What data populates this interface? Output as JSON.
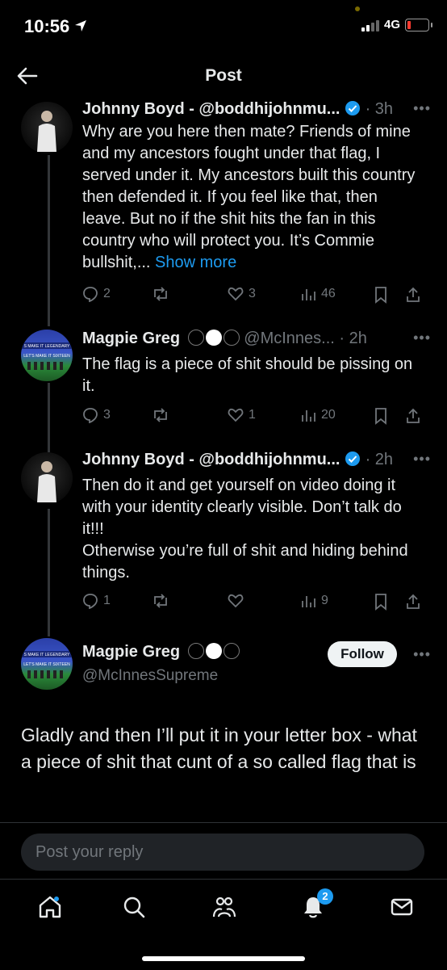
{
  "status": {
    "time": "10:56",
    "network": "4G"
  },
  "nav": {
    "title": "Post"
  },
  "tweets": [
    {
      "name": "Johnny Boyd - @boddhijohnmu...",
      "handle": "",
      "time": "· 3h",
      "text": "Why are you here then mate? Friends of mine and my ancestors fought under that flag, I served under it. My ancestors built this country then defended it. If you feel like that, then leave. But no if the shit hits the fan in this country who will protect you. It’s Commie bullshit,... ",
      "show_more": "Show more",
      "replies": "2",
      "reposts": "",
      "likes": "3",
      "views": "46"
    },
    {
      "name": "Magpie Greg",
      "handle": "@McInnes... · 2h",
      "text": "The flag is a piece of shit should be pissing on it.",
      "replies": "3",
      "reposts": "",
      "likes": "1",
      "views": "20"
    },
    {
      "name": "Johnny Boyd - @boddhijohnmu...",
      "handle": "",
      "time": "· 2h",
      "text": "Then do it and get yourself on video doing it with your identity clearly visible. Don’t talk do it!!!\nOtherwise you’re full of shit and hiding behind things.",
      "replies": "1",
      "reposts": "",
      "likes": "",
      "views": "9"
    }
  ],
  "main_post": {
    "name": "Magpie Greg",
    "handle": "@McInnesSupreme",
    "follow_label": "Follow",
    "text": "Gladly and then I’ll put it in your letter box - what a piece of shit that cunt of a so called flag that is"
  },
  "reply": {
    "placeholder": "Post your reply"
  },
  "bottom_nav": {
    "notification_count": "2"
  },
  "colors": {
    "accent": "#1d9bf0",
    "muted": "#71767b",
    "text": "#e7e9ea",
    "background": "#000000"
  }
}
